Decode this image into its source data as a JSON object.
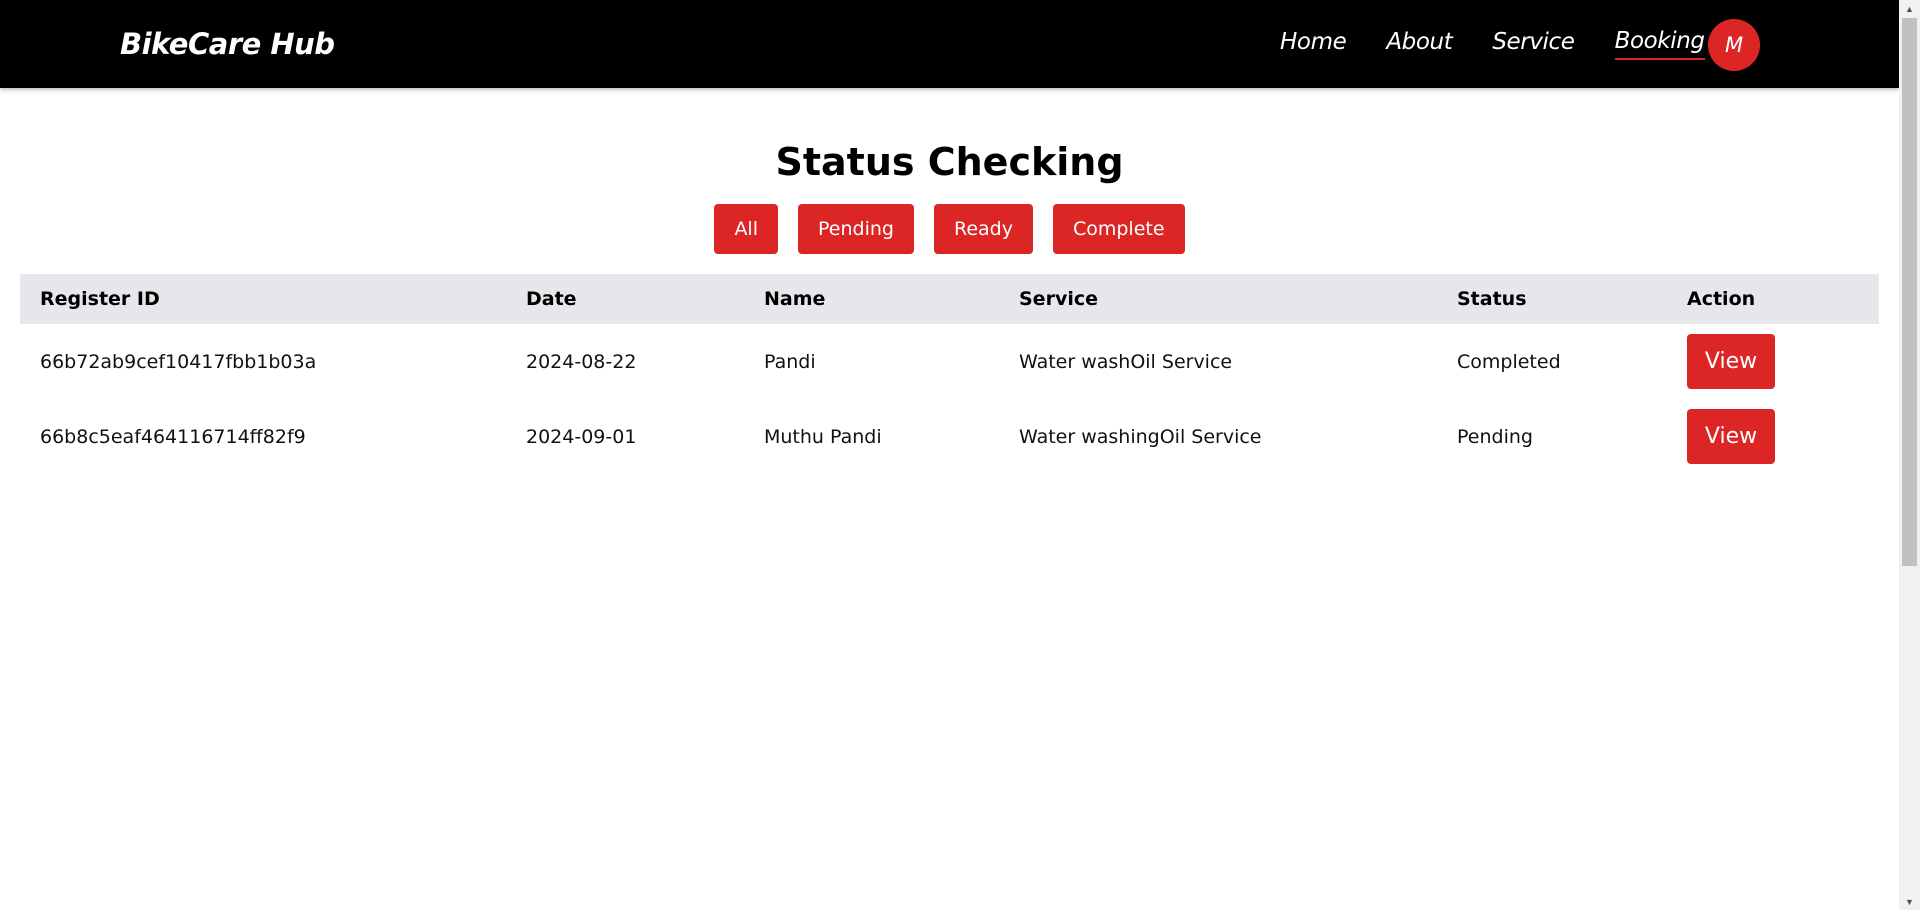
{
  "nav": {
    "brand": "BikeCare Hub",
    "links": [
      {
        "label": "Home"
      },
      {
        "label": "About"
      },
      {
        "label": "Service"
      },
      {
        "label": "Booking"
      }
    ],
    "avatar_initial": "M"
  },
  "main": {
    "title": "Status Checking",
    "filters": [
      "All",
      "Pending",
      "Ready",
      "Complete"
    ]
  },
  "table": {
    "headers": [
      "Register ID",
      "Date",
      "Name",
      "Service",
      "Status",
      "Action"
    ],
    "rows": [
      {
        "id": "66b72ab9cef10417fbb1b03a",
        "date": "2024-08-22",
        "name": "Pandi",
        "service": "Water washOil Service",
        "status": "Completed",
        "action": "View"
      },
      {
        "id": "66b8c5eaf464116714ff82f9",
        "date": "2024-09-01",
        "name": "Muthu Pandi",
        "service": "Water washingOil Service",
        "status": "Pending",
        "action": "View"
      }
    ]
  },
  "colors": {
    "accent": "#dc2626",
    "navbar": "#000000",
    "table_header": "#e5e7eb"
  }
}
